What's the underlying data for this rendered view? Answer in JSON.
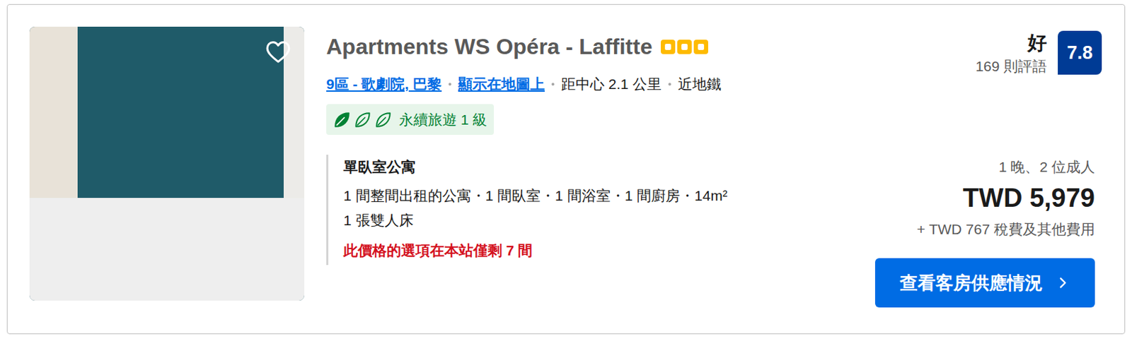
{
  "listing": {
    "title": "Apartments WS Opéra - Laffitte",
    "stars": 3,
    "favorite": false,
    "location": "9區 - 歌劇院, 巴黎",
    "map_link": "顯示在地圖上",
    "distance": "距中心 2.1 公里",
    "transit": "近地鐵",
    "sustainability": {
      "label": "永續旅遊 1 級",
      "leaves": [
        {
          "filled": true
        },
        {
          "filled": false
        },
        {
          "filled": false
        }
      ]
    }
  },
  "room": {
    "name": "單臥室公寓",
    "details": "1 間整間出租的公寓・1 間臥室・1 間浴室・1 間廚房・14m²",
    "bed": "1 張雙人床",
    "scarcity": "此價格的選項在本站僅剩 7 間"
  },
  "review": {
    "label": "好",
    "count": "169 則評語",
    "score": "7.8"
  },
  "price": {
    "stay": "1 晚、2 位成人",
    "amount": "TWD 5,979",
    "taxes": "+ TWD 767 稅費及其他費用"
  },
  "button": {
    "label": "查看客房供應情況"
  }
}
